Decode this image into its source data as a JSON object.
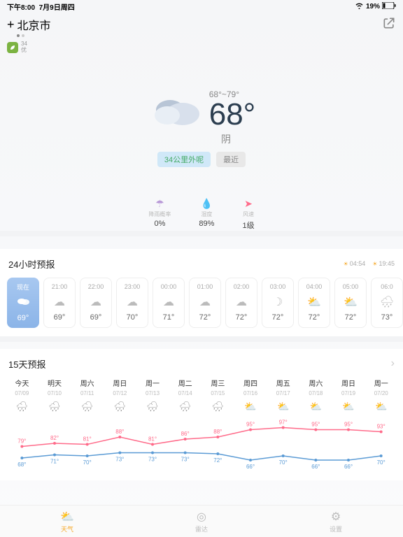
{
  "status": {
    "time": "下午8:00",
    "date": "7月9日周四",
    "battery": "19%"
  },
  "location": {
    "city": "北京市"
  },
  "aqi": {
    "value": "34",
    "level": "优"
  },
  "hero": {
    "range": "68°~79°",
    "temp": "68°",
    "cond": "阴",
    "chip1": "34公里外呢",
    "chip2": "最近"
  },
  "metrics": {
    "rain": {
      "label": "降雨概率",
      "value": "0%"
    },
    "humidity": {
      "label": "湿度",
      "value": "89%"
    },
    "wind": {
      "label": "风速",
      "value": "1级"
    }
  },
  "hourly": {
    "title": "24小时预报",
    "sunrise": "04:54",
    "sunset": "19:45",
    "items": [
      {
        "t": "现在",
        "icon": "cloud",
        "temp": "69°",
        "now": true
      },
      {
        "t": "21:00",
        "icon": "cloud",
        "temp": "69°"
      },
      {
        "t": "22:00",
        "icon": "cloud",
        "temp": "69°"
      },
      {
        "t": "23:00",
        "icon": "cloud",
        "temp": "70°"
      },
      {
        "t": "00:00",
        "icon": "cloud",
        "temp": "71°"
      },
      {
        "t": "01:00",
        "icon": "cloud",
        "temp": "72°"
      },
      {
        "t": "02:00",
        "icon": "cloud",
        "temp": "72°"
      },
      {
        "t": "03:00",
        "icon": "moon",
        "temp": "72°"
      },
      {
        "t": "04:00",
        "icon": "partly",
        "temp": "72°"
      },
      {
        "t": "05:00",
        "icon": "partly",
        "temp": "72°"
      },
      {
        "t": "06:0",
        "icon": "rain",
        "temp": "73°"
      }
    ]
  },
  "daily": {
    "title": "15天预报",
    "days": [
      {
        "name": "今天",
        "date": "07/09",
        "icon": "rain"
      },
      {
        "name": "明天",
        "date": "07/10",
        "icon": "rain"
      },
      {
        "name": "周六",
        "date": "07/11",
        "icon": "rain"
      },
      {
        "name": "周日",
        "date": "07/12",
        "icon": "rain"
      },
      {
        "name": "周一",
        "date": "07/13",
        "icon": "rain"
      },
      {
        "name": "周二",
        "date": "07/14",
        "icon": "rain"
      },
      {
        "name": "周三",
        "date": "07/15",
        "icon": "rain"
      },
      {
        "name": "周四",
        "date": "07/16",
        "icon": "partly"
      },
      {
        "name": "周五",
        "date": "07/17",
        "icon": "partly"
      },
      {
        "name": "周六",
        "date": "07/18",
        "icon": "partly"
      },
      {
        "name": "周日",
        "date": "07/19",
        "icon": "partly"
      },
      {
        "name": "周一",
        "date": "07/20",
        "icon": "partly"
      }
    ]
  },
  "chart_data": {
    "type": "line",
    "categories": [
      "07/09",
      "07/10",
      "07/11",
      "07/12",
      "07/13",
      "07/14",
      "07/15",
      "07/16",
      "07/17",
      "07/18",
      "07/19",
      "07/20"
    ],
    "series": [
      {
        "name": "high",
        "values": [
          79,
          82,
          81,
          88,
          81,
          86,
          88,
          95,
          97,
          95,
          95,
          93
        ],
        "color": "#ff6b8a"
      },
      {
        "name": "low",
        "values": [
          68,
          71,
          70,
          73,
          73,
          73,
          72,
          66,
          70,
          66,
          66,
          70
        ],
        "color": "#5b9bd5"
      }
    ],
    "ylim": [
      60,
      100
    ]
  },
  "tabs": [
    {
      "label": "天气",
      "active": true
    },
    {
      "label": "雷达"
    },
    {
      "label": "设置"
    }
  ]
}
